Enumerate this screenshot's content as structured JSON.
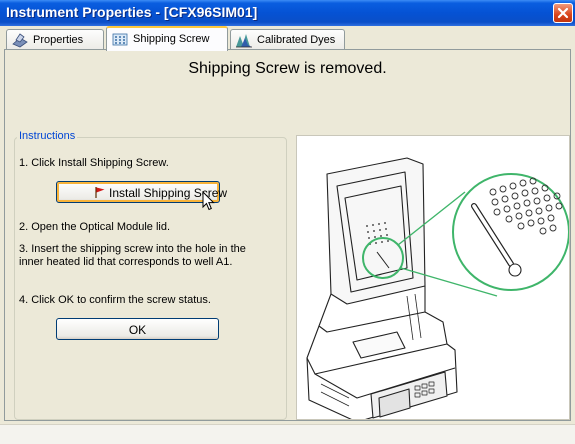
{
  "window": {
    "title": "Instrument Properties - [CFX96SIM01]",
    "accent_color": "#0a5ee0",
    "close_icon": "close-icon"
  },
  "tabs": [
    {
      "label": "Properties",
      "icon": "instrument-icon",
      "active": false
    },
    {
      "label": "Shipping Screw",
      "icon": "plate-icon",
      "active": true
    },
    {
      "label": "Calibrated Dyes",
      "icon": "dye-spectrum-icon",
      "active": false
    }
  ],
  "status_message": "Shipping Screw is removed.",
  "instructions": {
    "title": "Instructions",
    "step1": "1. Click Install Shipping Screw.",
    "install_button_label": "Install Shipping Screw",
    "step2": "2. Open the Optical Module lid.",
    "step3_line1": "3. Insert the shipping screw into the hole in the",
    "step3_line2": "inner heated lid that corresponds to well A1.",
    "step4": "4. Click OK to confirm the screw status.",
    "ok_button_label": "OK"
  },
  "illustration": {
    "name": "instrument-open-lid-illustration",
    "highlight_color": "#3fb56a"
  }
}
